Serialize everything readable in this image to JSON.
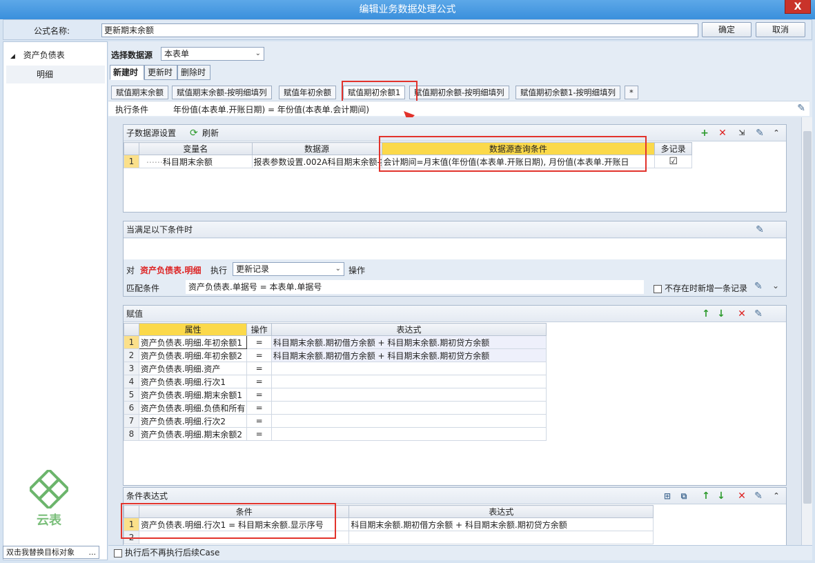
{
  "window": {
    "title": "编辑业务数据处理公式",
    "close_label": "X"
  },
  "header": {
    "name_label": "公式名称:",
    "name_value": "更新期末余额",
    "ok_label": "确定",
    "cancel_label": "取消"
  },
  "sidebar": {
    "root": "资产负债表",
    "child": "明细",
    "logo_text": "云表",
    "status": "双击我替换目标对象",
    "status_more": "..."
  },
  "datasource": {
    "label": "选择数据源",
    "value": "本表单"
  },
  "subtabs": [
    "新建时",
    "更新时",
    "删除时"
  ],
  "formula_tabs": [
    "赋值期末余额",
    "赋值期末余额-按明细填列",
    "赋值年初余额",
    "赋值期初余额1",
    "赋值期初余额-按明细填列",
    "赋值期初余额1-按明细填列",
    "*"
  ],
  "exec_condition": {
    "label": "执行条件",
    "value": "年份值(本表单.开账日期) = 年份值(本表单.会计期间)"
  },
  "sub_ds_panel": {
    "title": "子数据源设置",
    "refresh_label": "刷新",
    "columns": [
      "变量名",
      "数据源",
      "数据源查询条件",
      "多记录"
    ],
    "rows": [
      {
        "num": "1",
        "var": "科目期末余额",
        "source": "报表参数设置.002A科目期末余额-按",
        "condition": "会计期间=月末值(年份值(本表单.开账日期), 月份值(本表单.开账日",
        "multi": "☑"
      }
    ]
  },
  "cond_panel": {
    "title": "当满足以下条件时",
    "on_label": "对",
    "target": "资产负债表.明细",
    "exec_label": "执行",
    "action": "更新记录",
    "op_label": "操作",
    "match_label": "匹配条件",
    "match_value": "资产负债表.单据号 = 本表单.单据号",
    "not_exist_label": "不存在时新增一条记录"
  },
  "assign_panel": {
    "title": "赋值",
    "columns": [
      "属性",
      "操作",
      "表达式"
    ],
    "rows": [
      {
        "num": "1",
        "attr": "资产负债表.明细.年初余额1",
        "op": "=",
        "expr": "科目期末余额.期初借方余额 + 科目期末余额.期初贷方余额"
      },
      {
        "num": "2",
        "attr": "资产负债表.明细.年初余额2",
        "op": "=",
        "expr": "科目期末余额.期初借方余额 + 科目期末余额.期初贷方余额"
      },
      {
        "num": "3",
        "attr": "资产负债表.明细.资产",
        "op": "=",
        "expr": ""
      },
      {
        "num": "4",
        "attr": "资产负债表.明细.行次1",
        "op": "=",
        "expr": ""
      },
      {
        "num": "5",
        "attr": "资产负债表.明细.期末余额1",
        "op": "=",
        "expr": ""
      },
      {
        "num": "6",
        "attr": "资产负债表.明细.负债和所有",
        "op": "=",
        "expr": ""
      },
      {
        "num": "7",
        "attr": "资产负债表.明细.行次2",
        "op": "=",
        "expr": ""
      },
      {
        "num": "8",
        "attr": "资产负债表.明细.期末余额2",
        "op": "=",
        "expr": ""
      }
    ]
  },
  "cond_expr_panel": {
    "title": "条件表达式",
    "columns": [
      "条件",
      "表达式"
    ],
    "rows": [
      {
        "num": "1",
        "cond": "资产负债表.明细.行次1 = 科目期末余额.显示序号",
        "expr": "科目期末余额.期初借方余额 + 科目期末余额.期初贷方余额"
      },
      {
        "num": "2",
        "cond": "",
        "expr": ""
      }
    ]
  },
  "footer": {
    "stop_label": "执行后不再执行后续Case"
  },
  "colors": {
    "accent": "#3a8fdc",
    "highlight": "#e2322b",
    "selected_header": "#fbd94a"
  }
}
